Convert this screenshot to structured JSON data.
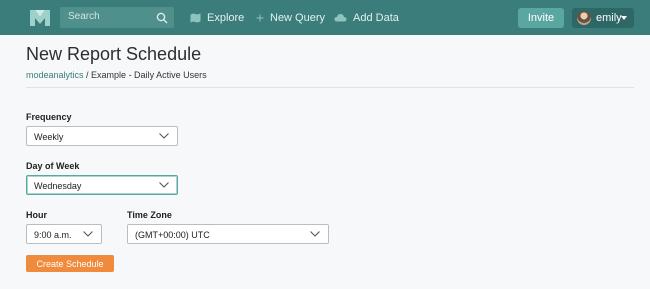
{
  "topbar": {
    "search_placeholder": "Search",
    "nav": [
      {
        "label": "Explore"
      },
      {
        "label": "New Query"
      },
      {
        "label": "Add Data"
      }
    ],
    "invite_label": "Invite",
    "user_name": "emily"
  },
  "page": {
    "title": "New Report Schedule",
    "breadcrumb_link": "modeanalytics",
    "breadcrumb_sep": " / ",
    "breadcrumb_current": "Example - Daily Active Users"
  },
  "form": {
    "frequency_label": "Frequency",
    "frequency_value": "Weekly",
    "day_label": "Day of Week",
    "day_value": "Wednesday",
    "hour_label": "Hour",
    "hour_value": "9:00 a.m.",
    "timezone_label": "Time Zone",
    "timezone_value": "(GMT+00:00) UTC",
    "submit_label": "Create Schedule"
  },
  "colors": {
    "topbar": "#3a7d7a",
    "accent": "#5aa7a2",
    "button": "#f08a3c"
  }
}
